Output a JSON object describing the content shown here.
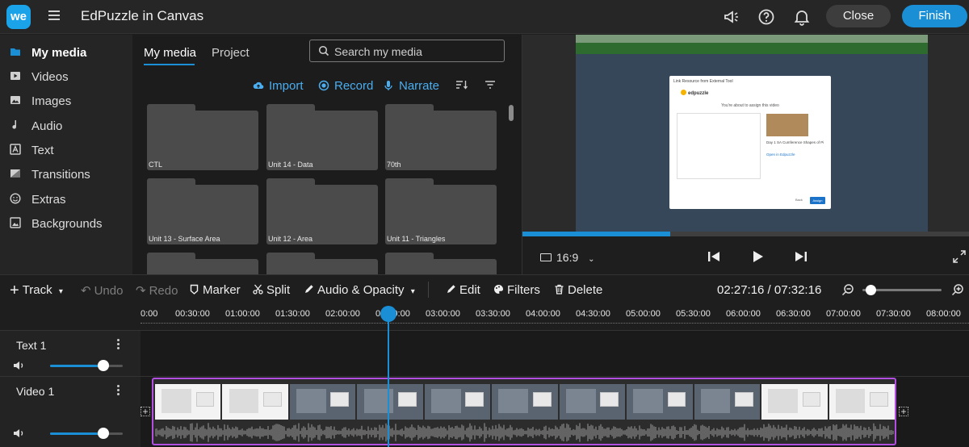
{
  "app": {
    "logo": "we",
    "title": "EdPuzzle in Canvas",
    "close_label": "Close",
    "finish_label": "Finish",
    "icons": [
      "hamburger-menu-icon",
      "announcement-icon",
      "help-icon",
      "notification-bell-icon"
    ]
  },
  "sidebar": {
    "items": [
      {
        "label": "My media",
        "icon": "folder-icon",
        "active": true
      },
      {
        "label": "Videos",
        "icon": "play-icon"
      },
      {
        "label": "Images",
        "icon": "image-icon"
      },
      {
        "label": "Audio",
        "icon": "music-note-icon"
      },
      {
        "label": "Text",
        "icon": "text-icon"
      },
      {
        "label": "Transitions",
        "icon": "transition-icon"
      },
      {
        "label": "Extras",
        "icon": "smiley-icon"
      },
      {
        "label": "Backgrounds",
        "icon": "background-icon"
      }
    ]
  },
  "media": {
    "tabs": [
      {
        "label": "My media",
        "active": true
      },
      {
        "label": "Project"
      }
    ],
    "search_placeholder": "Search my media",
    "actions": {
      "import": "Import",
      "record": "Record",
      "narrate": "Narrate"
    },
    "folders": [
      "CTL",
      "Unit 14 - Data",
      "70th",
      "Unit 13 - Surface Area",
      "Unit 12 - Area",
      "Unit 11 - Triangles",
      "",
      "",
      ""
    ]
  },
  "preview": {
    "aspect_ratio": "16:9",
    "progress": 0.33,
    "dialog": {
      "title": "Link Resource from External Tool",
      "brand": "edpuzzle",
      "heading": "You're about to assign this video",
      "video_title": "Day 1 SA Cumference Shapes of Pi",
      "open_link": "Open in Edpuzzle",
      "back": "Back",
      "assign": "Assign"
    }
  },
  "timeline_toolbar": {
    "track": "Track",
    "undo": "Undo",
    "redo": "Redo",
    "marker": "Marker",
    "split": "Split",
    "audio_opacity": "Audio & Opacity",
    "edit": "Edit",
    "filters": "Filters",
    "delete": "Delete",
    "timecode": "02:27:16 / 07:32:16",
    "zoom_level": 0.04
  },
  "ruler": {
    "ticks": [
      "0:00",
      "00:30:00",
      "01:00:00",
      "01:30:00",
      "02:00:00",
      "02:30:00",
      "03:00:00",
      "03:30:00",
      "04:00:00",
      "04:30:00",
      "05:00:00",
      "05:30:00",
      "06:00:00",
      "06:30:00",
      "07:00:00",
      "07:30:00",
      "08:00:00"
    ]
  },
  "tracks": [
    {
      "name": "Text 1",
      "volume": 0.73
    },
    {
      "name": "Video 1",
      "volume": 0.73
    }
  ],
  "colors": {
    "accent": "#1a8fd6",
    "clip_border": "#b24fe0",
    "panel": "#252525",
    "background": "#1e1e1e"
  }
}
